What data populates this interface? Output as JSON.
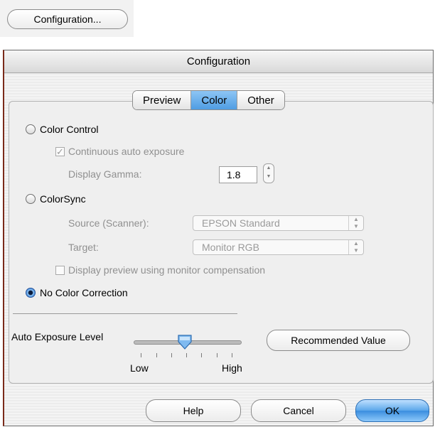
{
  "top_button": {
    "label": "Configuration..."
  },
  "dialog": {
    "title": "Configuration",
    "tabs": [
      {
        "label": "Preview",
        "active": false
      },
      {
        "label": "Color",
        "active": true
      },
      {
        "label": "Other",
        "active": false
      }
    ],
    "color_control": {
      "label": "Color Control",
      "selected": false,
      "continuous_auto_exposure": {
        "label": "Continuous auto exposure",
        "checked": true
      },
      "display_gamma": {
        "label": "Display Gamma:",
        "value": "1.8"
      }
    },
    "colorsync": {
      "label": "ColorSync",
      "selected": false,
      "source": {
        "label": "Source (Scanner):",
        "value": "EPSON Standard"
      },
      "target": {
        "label": "Target:",
        "value": "Monitor RGB"
      },
      "display_preview": {
        "label": "Display preview using monitor compensation",
        "checked": false
      }
    },
    "no_color_correction": {
      "label": "No Color Correction",
      "selected": true
    },
    "auto_exposure": {
      "label": "Auto Exposure Level",
      "min_label": "Low",
      "max_label": "High",
      "level": 0.5,
      "recommended_button": "Recommended Value"
    },
    "buttons": {
      "help": "Help",
      "cancel": "Cancel",
      "ok": "OK"
    }
  }
}
